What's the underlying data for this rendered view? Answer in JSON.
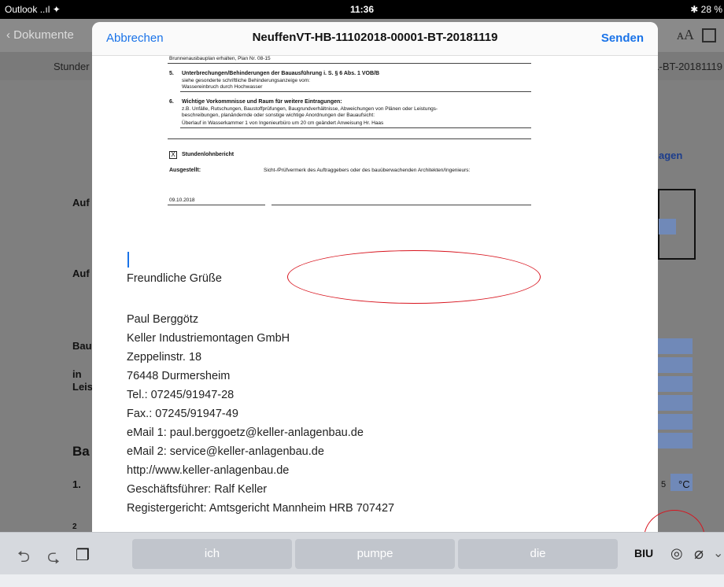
{
  "status": {
    "carrier": "Outlook",
    "signal": "..ıl ✦",
    "time": "11:36",
    "battery": "✱ 28 %"
  },
  "background": {
    "back_label": "Dokumente",
    "aa_label": "ᴀA",
    "sub_left": "Stunder",
    "sub_right": "1-BT-20181119",
    "heading_frag": "agen",
    "labels": [
      "Auf",
      "Auf",
      "Bau",
      "in",
      "Leis",
      "Ba",
      "1.",
      "2"
    ],
    "unit": "°C",
    "digit": "5"
  },
  "compose": {
    "cancel": "Abbrechen",
    "title": "NeuffenVT-HB-11102018-00001-BT-20181119",
    "send": "Senden"
  },
  "doc": {
    "line0": "Brunnenausbauplan erhalten, Plan Nr. 08-15",
    "s5_num": "5.",
    "s5_title": "Unterbrechungen/Behinderungen der Bauausführung i. S. § 6 Abs. 1 VOB/B",
    "s5_sub": "siehe gesonderte schriftliche Behinderungsanzeige vom:",
    "s5_val": "Wassereinbruch durch Hochwasser",
    "s6_num": "6.",
    "s6_title": "Wichtige Vorkommnisse und Raum für weitere Eintragungen:",
    "s6_sub1": "z.B. Unfälle, Rutschungen, Baustoffprüfungen, Baugrundverhältnisse, Abweichungen von Plänen oder Leistungs-",
    "s6_sub2": "beschreibungen, planändernde oder sonstige wichtige Anordnungen der Bauaufsicht:",
    "s6_val": "Überlauf in Wasserkammer 1 von Ingenieurbüro um 20 cm geändert Anweisung Hr. Haas",
    "check_mark": "X",
    "check_label": "Stundenlohnbericht",
    "issued_label": "Ausgestellt:",
    "sight_label": "Sicht-/Prüfvermerk des Auftraggebers oder des bauüberwachenden Architekten/Ingenieurs:",
    "date": "09.10.2018"
  },
  "signature": [
    "Freundliche Grüße",
    "Paul Berggötz",
    "Keller Industriemontagen GmbH",
    "Zeppelinstr. 18",
    "76448 Durmersheim",
    "Tel.: 07245/91947-28",
    "Fax.: 07245/91947-49",
    "eMail 1: paul.berggoetz@keller-anlagenbau.de",
    "eMail 2: service@keller-anlagenbau.de",
    "http://www.keller-anlagenbau.de",
    "Geschäftsführer: Ralf Keller",
    "Registergericht: Amtsgericht Mannheim HRB 707427"
  ],
  "keyboard": {
    "undo": "⮌",
    "redo": "⮎",
    "paste": "❐",
    "suggestions": [
      "ich",
      "pumpe",
      "die"
    ],
    "format": "BIU",
    "camera": "◎",
    "attach": "⌀",
    "more": "⌄"
  },
  "colors": {
    "accent": "#1a73e8",
    "annotation": "#d8141e",
    "form_field": "#7089b8"
  }
}
